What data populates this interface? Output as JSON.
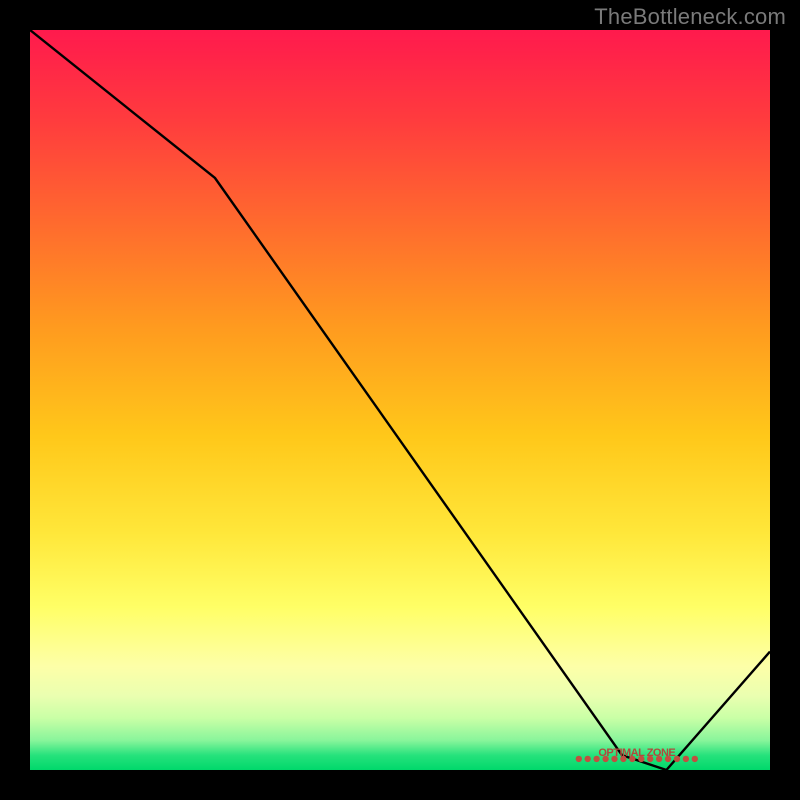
{
  "attribution": "TheBottleneck.com",
  "chart_data": {
    "type": "line",
    "title": "",
    "xlabel": "",
    "ylabel": "",
    "xlim": [
      0,
      100
    ],
    "ylim": [
      0,
      100
    ],
    "grid": false,
    "series": [
      {
        "name": "bottleneck-curve",
        "x": [
          0,
          25,
          80,
          86,
          100
        ],
        "y": [
          100,
          80,
          2,
          0,
          16
        ]
      }
    ],
    "annotations": [
      {
        "name": "optimal-zone",
        "x": 82,
        "y": 1.5,
        "text": "OPTIMAL ZONE"
      }
    ]
  },
  "colors": {
    "curve": "#000000",
    "zone_marker": "#c05040",
    "bg_top": "#ff1a4d",
    "bg_bottom": "#00d86b"
  }
}
